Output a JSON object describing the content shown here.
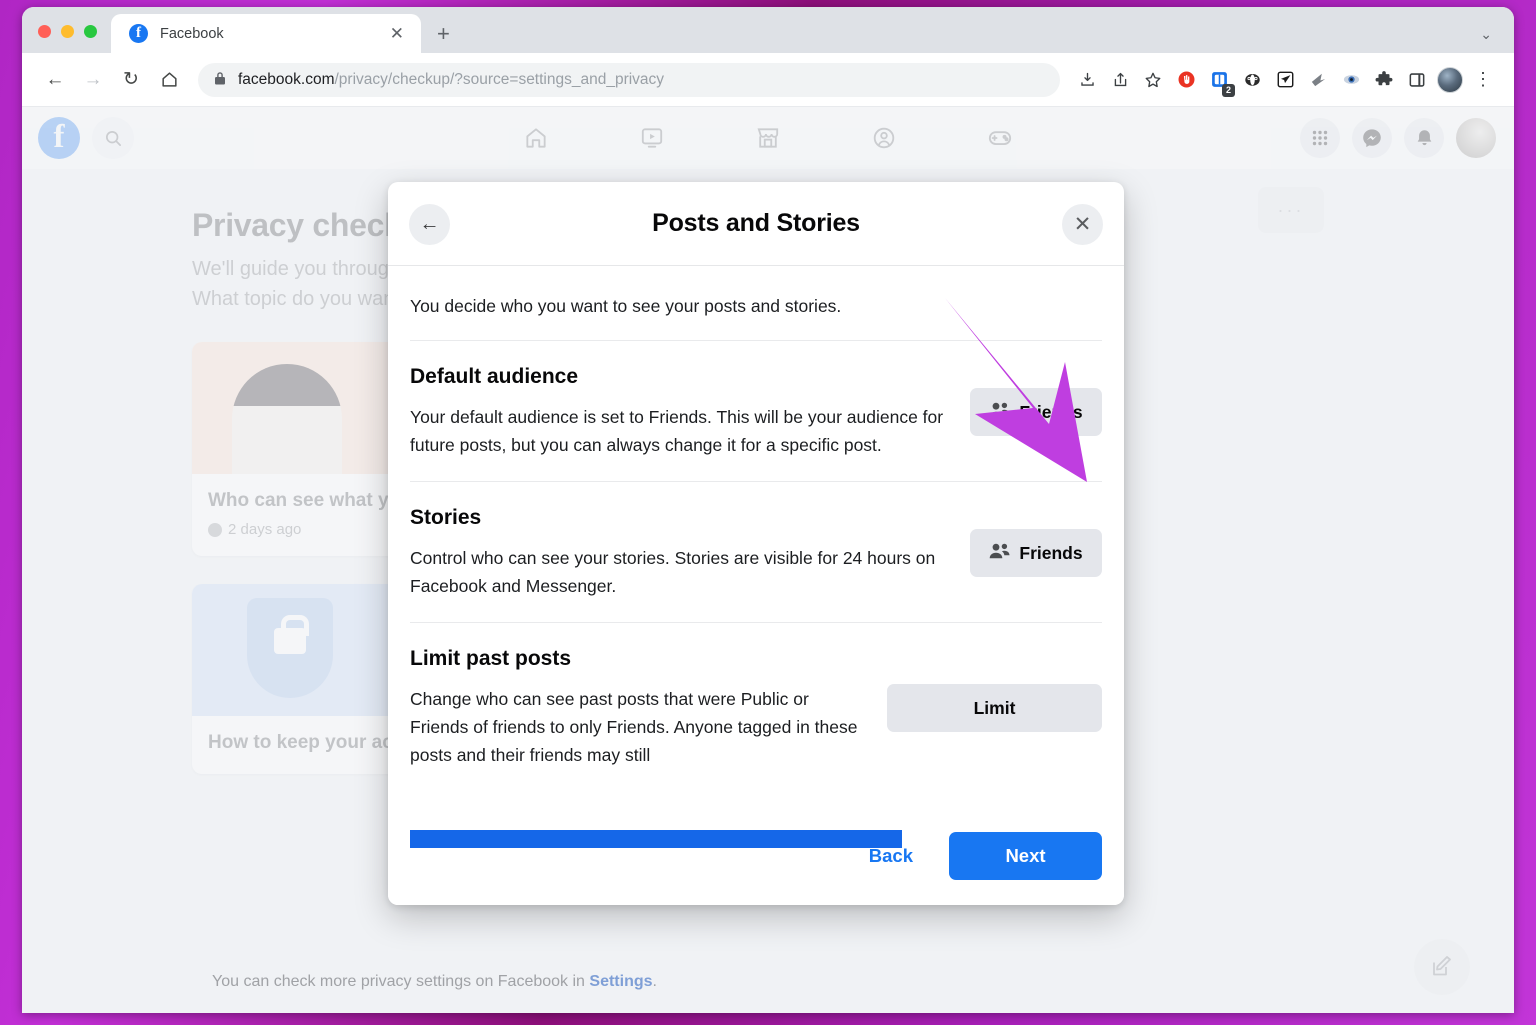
{
  "browser": {
    "tab": {
      "title": "Facebook",
      "favicon": "facebook-icon",
      "close": "✕"
    },
    "new_tab": "+",
    "window_chevron": "⌄",
    "nav": {
      "back": "←",
      "forward": "→",
      "reload": "↻",
      "home": "⌂"
    },
    "omnibox": {
      "lock": "🔒",
      "url_domain": "facebook.com",
      "url_path": "/privacy/checkup/?source=settings_and_privacy"
    },
    "extensions": [
      {
        "name": "install-icon",
        "glyph": "⤓"
      },
      {
        "name": "share-icon",
        "glyph": "⇧"
      },
      {
        "name": "bookmark-star-icon",
        "glyph": "☆"
      },
      {
        "name": "adblock-icon",
        "glyph": "✋",
        "color": "#ea3323"
      },
      {
        "name": "notes-extension-icon",
        "glyph": "▧",
        "color": "#1a73e8",
        "badge": "2"
      },
      {
        "name": "privacy-badger-icon",
        "glyph": "◑",
        "color": "#2b2b2b"
      },
      {
        "name": "telegram-extension-icon",
        "glyph": "➤",
        "color": "#1c1c1c"
      },
      {
        "name": "grammarly-icon",
        "glyph": "➡",
        "color": "#6b6f73"
      },
      {
        "name": "eye-extension-icon",
        "glyph": "◉",
        "color": "#3b6fb6"
      },
      {
        "name": "puzzle-extensions-icon",
        "glyph": "❖",
        "color": "#3c4043"
      },
      {
        "name": "side-panel-icon",
        "glyph": "▭",
        "color": "#3c4043"
      }
    ],
    "profile_avatar": "chrome-profile-avatar",
    "menu": "⋮"
  },
  "facebook": {
    "logo": "f",
    "search_icon": "⌕",
    "nav_tabs": [
      "home-icon",
      "video-icon",
      "marketplace-icon",
      "groups-icon",
      "gaming-icon"
    ],
    "right_icons": [
      "menu-grid-icon",
      "messenger-icon",
      "notifications-icon"
    ],
    "page": {
      "title": "Privacy checkup",
      "subtitle_line1": "We'll guide you through some settings so you can make the right choices for your account.",
      "subtitle_line2": "What topic do you want to start with?",
      "cards": [
        {
          "title": "Who can see what you share",
          "meta": "2 days ago",
          "image": "woman-phone-illustration"
        },
        {
          "title": "How to keep your account secure",
          "meta": "",
          "image": "shield-lock-illustration"
        }
      ],
      "footer_text": "You can check more privacy settings on Facebook in ",
      "footer_link": "Settings",
      "footer_period": ".",
      "more_button": "···",
      "compose_fab": "✎"
    }
  },
  "modal": {
    "back_icon": "←",
    "close_icon": "✕",
    "title": "Posts and Stories",
    "intro": "You decide who you want to see your posts and stories.",
    "sections": [
      {
        "heading": "Default audience",
        "body": "Your default audience is set to Friends. This will be your audience for future posts, but you can always change it for a specific post.",
        "button": "Friends",
        "button_icon": "friends-icon"
      },
      {
        "heading": "Stories",
        "body": "Control who can see your stories. Stories are visible for 24 hours on Facebook and Messenger.",
        "button": "Friends",
        "button_icon": "friends-icon"
      },
      {
        "heading": "Limit past posts",
        "body": "Change who can see past posts that were Public or Friends of friends to only Friends. Anyone tagged in these posts and their friends may still",
        "button": "Limit",
        "button_icon": ""
      }
    ],
    "footer": {
      "back": "Back",
      "next": "Next"
    }
  },
  "annotation": {
    "arrow_color": "#bf3ee0",
    "arrow_target": "default-audience-friends-button",
    "highlight_bar_color": "#1567e8"
  }
}
